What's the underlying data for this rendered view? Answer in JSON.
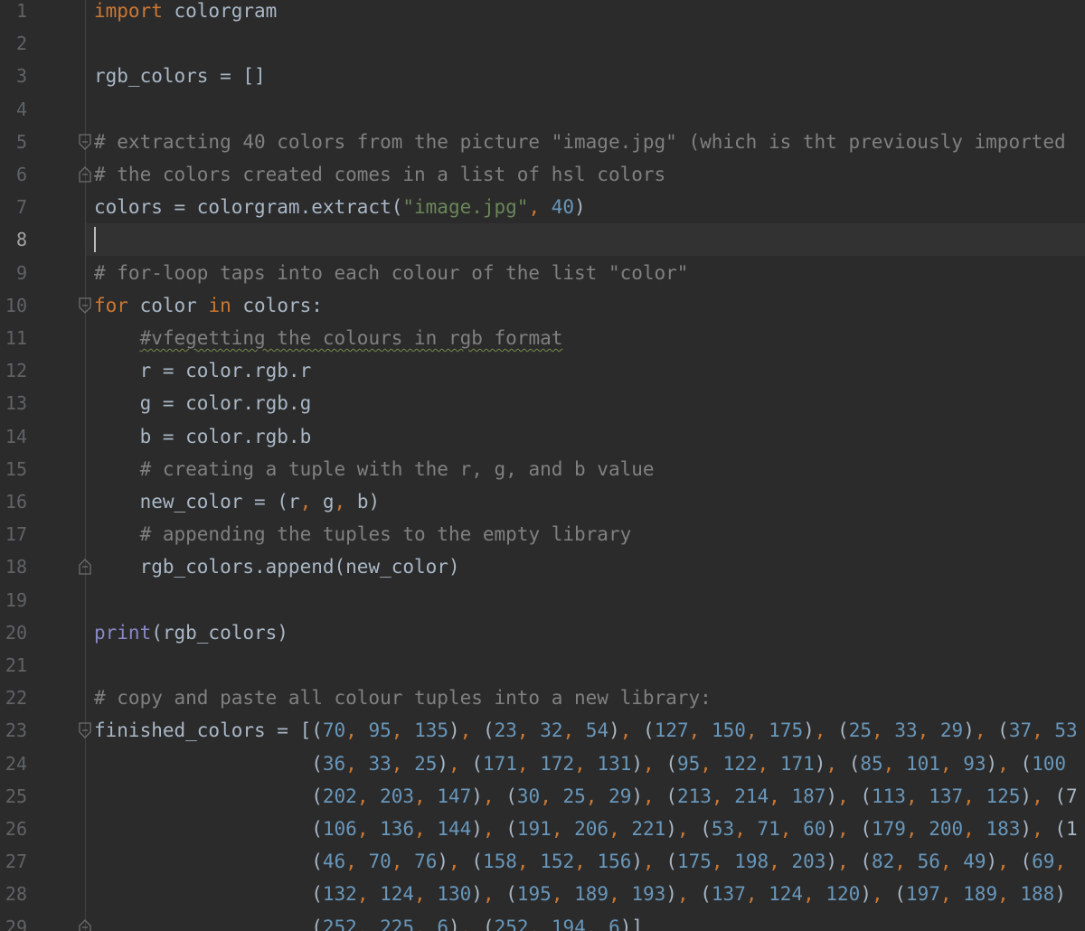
{
  "editor": {
    "lines": [
      {
        "n": "1",
        "tokens": [
          [
            "kw",
            "import"
          ],
          [
            "",
            " colorgram"
          ]
        ]
      },
      {
        "n": "2",
        "tokens": []
      },
      {
        "n": "3",
        "tokens": [
          [
            "",
            "rgb_colors = []"
          ]
        ]
      },
      {
        "n": "4",
        "tokens": []
      },
      {
        "n": "5",
        "fold": "open",
        "tokens": [
          [
            "cm",
            "# extracting 40 colors from the picture \"image.jpg\" (which is tht previously imported"
          ]
        ]
      },
      {
        "n": "6",
        "fold": "close",
        "tokens": [
          [
            "cm",
            "# the colors created comes in a list of hsl colors"
          ]
        ]
      },
      {
        "n": "7",
        "tokens": [
          [
            "",
            "colors = colorgram.extract("
          ],
          [
            "str",
            "\"image.jpg\""
          ],
          [
            "punc",
            ", "
          ],
          [
            "num",
            "40"
          ],
          [
            "",
            ")"
          ]
        ]
      },
      {
        "n": "8",
        "current": true,
        "tokens": []
      },
      {
        "n": "9",
        "tokens": [
          [
            "cm",
            "# for-loop taps into each colour of the list \"color\""
          ]
        ]
      },
      {
        "n": "10",
        "fold": "open",
        "tokens": [
          [
            "kw",
            "for"
          ],
          [
            "",
            " color "
          ],
          [
            "kw",
            "in"
          ],
          [
            "",
            " colors:"
          ]
        ]
      },
      {
        "n": "11",
        "tokens": [
          [
            "",
            "    "
          ],
          [
            "cm typo",
            "#vfegetting the colours in rgb format"
          ]
        ]
      },
      {
        "n": "12",
        "tokens": [
          [
            "",
            "    r = color.rgb.r"
          ]
        ]
      },
      {
        "n": "13",
        "tokens": [
          [
            "",
            "    g = color.rgb.g"
          ]
        ]
      },
      {
        "n": "14",
        "tokens": [
          [
            "",
            "    b = color.rgb.b"
          ]
        ]
      },
      {
        "n": "15",
        "tokens": [
          [
            "",
            "    "
          ],
          [
            "cm",
            "# creating a tuple with the r, g, and b value"
          ]
        ]
      },
      {
        "n": "16",
        "tokens": [
          [
            "",
            "    new_color = (r"
          ],
          [
            "punc",
            ", "
          ],
          [
            "",
            "g"
          ],
          [
            "punc",
            ", "
          ],
          [
            "",
            "b)"
          ]
        ]
      },
      {
        "n": "17",
        "tokens": [
          [
            "",
            "    "
          ],
          [
            "cm",
            "# appending the tuples to the empty library"
          ]
        ]
      },
      {
        "n": "18",
        "fold": "close",
        "tokens": [
          [
            "",
            "    rgb_colors.append(new_color)"
          ]
        ]
      },
      {
        "n": "19",
        "tokens": []
      },
      {
        "n": "20",
        "tokens": [
          [
            "builtin",
            "print"
          ],
          [
            "",
            "(rgb_colors)"
          ]
        ]
      },
      {
        "n": "21",
        "tokens": []
      },
      {
        "n": "22",
        "tokens": [
          [
            "cm",
            "# copy and paste all colour tuples into a new library:"
          ]
        ]
      },
      {
        "n": "23",
        "fold": "open",
        "tokens": [
          [
            "",
            "finished_colors = [("
          ],
          [
            "num",
            "70"
          ],
          [
            "punc",
            ", "
          ],
          [
            "num",
            "95"
          ],
          [
            "punc",
            ", "
          ],
          [
            "num",
            "135"
          ],
          [
            "",
            ")"
          ],
          [
            "punc",
            ", "
          ],
          [
            "",
            "("
          ],
          [
            "num",
            "23"
          ],
          [
            "punc",
            ", "
          ],
          [
            "num",
            "32"
          ],
          [
            "punc",
            ", "
          ],
          [
            "num",
            "54"
          ],
          [
            "",
            ")"
          ],
          [
            "punc",
            ", "
          ],
          [
            "",
            "("
          ],
          [
            "num",
            "127"
          ],
          [
            "punc",
            ", "
          ],
          [
            "num",
            "150"
          ],
          [
            "punc",
            ", "
          ],
          [
            "num",
            "175"
          ],
          [
            "",
            ")"
          ],
          [
            "punc",
            ", "
          ],
          [
            "",
            "("
          ],
          [
            "num",
            "25"
          ],
          [
            "punc",
            ", "
          ],
          [
            "num",
            "33"
          ],
          [
            "punc",
            ", "
          ],
          [
            "num",
            "29"
          ],
          [
            "",
            ")"
          ],
          [
            "punc",
            ", "
          ],
          [
            "",
            "("
          ],
          [
            "num",
            "37"
          ],
          [
            "punc",
            ", "
          ],
          [
            "num",
            "53"
          ]
        ]
      },
      {
        "n": "24",
        "tokens": [
          [
            "",
            "                   ("
          ],
          [
            "num",
            "36"
          ],
          [
            "punc",
            ", "
          ],
          [
            "num",
            "33"
          ],
          [
            "punc",
            ", "
          ],
          [
            "num",
            "25"
          ],
          [
            "",
            ")"
          ],
          [
            "punc",
            ", "
          ],
          [
            "",
            "("
          ],
          [
            "num",
            "171"
          ],
          [
            "punc",
            ", "
          ],
          [
            "num",
            "172"
          ],
          [
            "punc",
            ", "
          ],
          [
            "num",
            "131"
          ],
          [
            "",
            ")"
          ],
          [
            "punc",
            ", "
          ],
          [
            "",
            "("
          ],
          [
            "num",
            "95"
          ],
          [
            "punc",
            ", "
          ],
          [
            "num",
            "122"
          ],
          [
            "punc",
            ", "
          ],
          [
            "num",
            "171"
          ],
          [
            "",
            ")"
          ],
          [
            "punc",
            ", "
          ],
          [
            "",
            "("
          ],
          [
            "num",
            "85"
          ],
          [
            "punc",
            ", "
          ],
          [
            "num",
            "101"
          ],
          [
            "punc",
            ", "
          ],
          [
            "num",
            "93"
          ],
          [
            "",
            ")"
          ],
          [
            "punc",
            ", "
          ],
          [
            "",
            "("
          ],
          [
            "num",
            "100"
          ]
        ]
      },
      {
        "n": "25",
        "tokens": [
          [
            "",
            "                   ("
          ],
          [
            "num",
            "202"
          ],
          [
            "punc",
            ", "
          ],
          [
            "num",
            "203"
          ],
          [
            "punc",
            ", "
          ],
          [
            "num",
            "147"
          ],
          [
            "",
            ")"
          ],
          [
            "punc",
            ", "
          ],
          [
            "",
            "("
          ],
          [
            "num",
            "30"
          ],
          [
            "punc",
            ", "
          ],
          [
            "num",
            "25"
          ],
          [
            "punc",
            ", "
          ],
          [
            "num",
            "29"
          ],
          [
            "",
            ")"
          ],
          [
            "punc",
            ", "
          ],
          [
            "",
            "("
          ],
          [
            "num",
            "213"
          ],
          [
            "punc",
            ", "
          ],
          [
            "num",
            "214"
          ],
          [
            "punc",
            ", "
          ],
          [
            "num",
            "187"
          ],
          [
            "",
            ")"
          ],
          [
            "punc",
            ", "
          ],
          [
            "",
            "("
          ],
          [
            "num",
            "113"
          ],
          [
            "punc",
            ", "
          ],
          [
            "num",
            "137"
          ],
          [
            "punc",
            ", "
          ],
          [
            "num",
            "125"
          ],
          [
            "",
            ")"
          ],
          [
            "punc",
            ", "
          ],
          [
            "",
            "(7"
          ]
        ]
      },
      {
        "n": "26",
        "tokens": [
          [
            "",
            "                   ("
          ],
          [
            "num",
            "106"
          ],
          [
            "punc",
            ", "
          ],
          [
            "num",
            "136"
          ],
          [
            "punc",
            ", "
          ],
          [
            "num",
            "144"
          ],
          [
            "",
            ")"
          ],
          [
            "punc",
            ", "
          ],
          [
            "",
            "("
          ],
          [
            "num",
            "191"
          ],
          [
            "punc",
            ", "
          ],
          [
            "num",
            "206"
          ],
          [
            "punc",
            ", "
          ],
          [
            "num",
            "221"
          ],
          [
            "",
            ")"
          ],
          [
            "punc",
            ", "
          ],
          [
            "",
            "("
          ],
          [
            "num",
            "53"
          ],
          [
            "punc",
            ", "
          ],
          [
            "num",
            "71"
          ],
          [
            "punc",
            ", "
          ],
          [
            "num",
            "60"
          ],
          [
            "",
            ")"
          ],
          [
            "punc",
            ", "
          ],
          [
            "",
            "("
          ],
          [
            "num",
            "179"
          ],
          [
            "punc",
            ", "
          ],
          [
            "num",
            "200"
          ],
          [
            "punc",
            ", "
          ],
          [
            "num",
            "183"
          ],
          [
            "",
            ")"
          ],
          [
            "punc",
            ", "
          ],
          [
            "",
            "(1"
          ]
        ]
      },
      {
        "n": "27",
        "tokens": [
          [
            "",
            "                   ("
          ],
          [
            "num",
            "46"
          ],
          [
            "punc",
            ", "
          ],
          [
            "num",
            "70"
          ],
          [
            "punc",
            ", "
          ],
          [
            "num",
            "76"
          ],
          [
            "",
            ")"
          ],
          [
            "punc",
            ", "
          ],
          [
            "",
            "("
          ],
          [
            "num",
            "158"
          ],
          [
            "punc",
            ", "
          ],
          [
            "num",
            "152"
          ],
          [
            "punc",
            ", "
          ],
          [
            "num",
            "156"
          ],
          [
            "",
            ")"
          ],
          [
            "punc",
            ", "
          ],
          [
            "",
            "("
          ],
          [
            "num",
            "175"
          ],
          [
            "punc",
            ", "
          ],
          [
            "num",
            "198"
          ],
          [
            "punc",
            ", "
          ],
          [
            "num",
            "203"
          ],
          [
            "",
            ")"
          ],
          [
            "punc",
            ", "
          ],
          [
            "",
            "("
          ],
          [
            "num",
            "82"
          ],
          [
            "punc",
            ", "
          ],
          [
            "num",
            "56"
          ],
          [
            "punc",
            ", "
          ],
          [
            "num",
            "49"
          ],
          [
            "",
            ")"
          ],
          [
            "punc",
            ", "
          ],
          [
            "",
            "("
          ],
          [
            "num",
            "69"
          ],
          [
            "punc",
            ","
          ]
        ]
      },
      {
        "n": "28",
        "tokens": [
          [
            "",
            "                   ("
          ],
          [
            "num",
            "132"
          ],
          [
            "punc",
            ", "
          ],
          [
            "num",
            "124"
          ],
          [
            "punc",
            ", "
          ],
          [
            "num",
            "130"
          ],
          [
            "",
            ")"
          ],
          [
            "punc",
            ", "
          ],
          [
            "",
            "("
          ],
          [
            "num",
            "195"
          ],
          [
            "punc",
            ", "
          ],
          [
            "num",
            "189"
          ],
          [
            "punc",
            ", "
          ],
          [
            "num",
            "193"
          ],
          [
            "",
            ")"
          ],
          [
            "punc",
            ", "
          ],
          [
            "",
            "("
          ],
          [
            "num",
            "137"
          ],
          [
            "punc",
            ", "
          ],
          [
            "num",
            "124"
          ],
          [
            "punc",
            ", "
          ],
          [
            "num",
            "120"
          ],
          [
            "",
            ")"
          ],
          [
            "punc",
            ", "
          ],
          [
            "",
            "("
          ],
          [
            "num",
            "197"
          ],
          [
            "punc",
            ", "
          ],
          [
            "num",
            "189"
          ],
          [
            "punc",
            ", "
          ],
          [
            "num",
            "188"
          ],
          [
            "",
            ")"
          ]
        ]
      },
      {
        "n": "29",
        "fold": "close",
        "tokens": [
          [
            "",
            "                   ("
          ],
          [
            "num",
            "252"
          ],
          [
            "punc",
            ", "
          ],
          [
            "num",
            "225"
          ],
          [
            "punc",
            ", "
          ],
          [
            "num",
            "6"
          ],
          [
            "",
            ")"
          ],
          [
            "punc",
            ", "
          ],
          [
            "",
            "("
          ],
          [
            "num",
            "252"
          ],
          [
            "punc",
            ", "
          ],
          [
            "num",
            "194"
          ],
          [
            "punc",
            ", "
          ],
          [
            "num",
            "6"
          ],
          [
            "",
            ")]"
          ]
        ]
      }
    ]
  }
}
